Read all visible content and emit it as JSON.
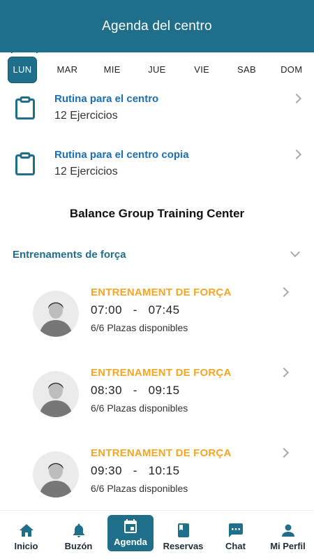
{
  "header": {
    "title": "Agenda del centro"
  },
  "days": [
    {
      "label": "LUN",
      "active": true
    },
    {
      "label": "MAR",
      "active": false
    },
    {
      "label": "MIE",
      "active": false
    },
    {
      "label": "JUE",
      "active": false
    },
    {
      "label": "VIE",
      "active": false
    },
    {
      "label": "SAB",
      "active": false
    },
    {
      "label": "DOM",
      "active": false
    }
  ],
  "routines": [
    {
      "title": "Rutina para el centro",
      "subtitle": "12 Ejercicios",
      "icon": "clipboard-icon"
    },
    {
      "title": "Rutina para el centro copia",
      "subtitle": "12 Ejercicios",
      "icon": "clipboard-icon"
    }
  ],
  "center_name": "Balance Group Training Center",
  "section": {
    "label": "Entrenaments de força"
  },
  "sessions": [
    {
      "title": "ENTRENAMENT DE FORÇA",
      "start": "07:00",
      "end": "07:45",
      "separator": "-",
      "places": "6/6 Plazas disponibles"
    },
    {
      "title": "ENTRENAMENT DE FORÇA",
      "start": "08:30",
      "end": "09:15",
      "separator": "-",
      "places": "6/6 Plazas disponibles"
    },
    {
      "title": "ENTRENAMENT DE FORÇA",
      "start": "09:30",
      "end": "10:15",
      "separator": "-",
      "places": "6/6 Plazas disponibles"
    }
  ],
  "tabs": [
    {
      "label": "Inicio",
      "icon": "home-icon",
      "active": false
    },
    {
      "label": "Buzón",
      "icon": "bell-icon",
      "active": false
    },
    {
      "label": "Agenda",
      "icon": "calendar-icon",
      "active": true
    },
    {
      "label": "Reservas",
      "icon": "book-icon",
      "active": false
    },
    {
      "label": "Chat",
      "icon": "chat-icon",
      "active": false
    },
    {
      "label": "Mi Perfil",
      "icon": "person-icon",
      "active": false
    }
  ],
  "colors": {
    "primary": "#1f6f8b",
    "link": "#1b6fb3",
    "accent": "#f5a623"
  }
}
